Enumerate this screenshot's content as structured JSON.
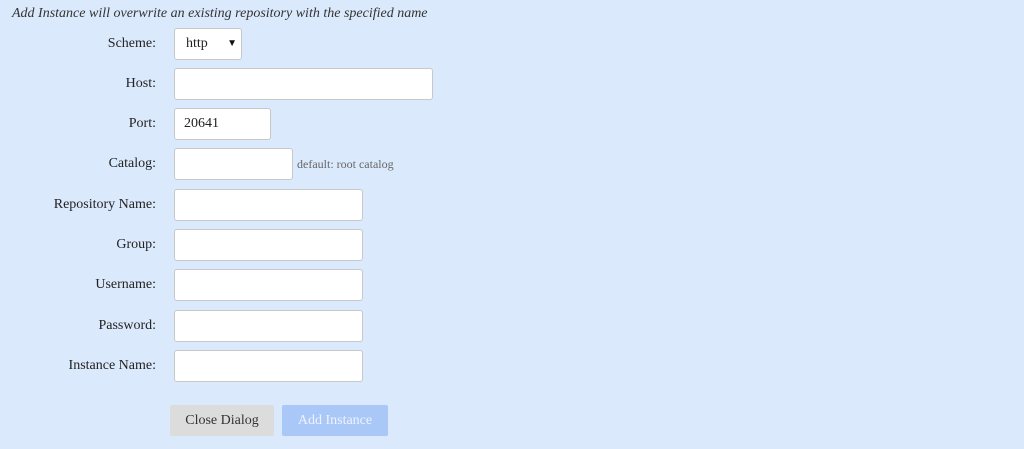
{
  "note": "Add Instance will overwrite an existing repository with the specified name",
  "form": {
    "scheme": {
      "label": "Scheme:",
      "value": "http",
      "icon": "caret-down-icon"
    },
    "host": {
      "label": "Host:",
      "value": ""
    },
    "port": {
      "label": "Port:",
      "value": "20641"
    },
    "catalog": {
      "label": "Catalog:",
      "value": "",
      "hint": "default: root catalog"
    },
    "repository_name": {
      "label": "Repository Name:",
      "value": ""
    },
    "group": {
      "label": "Group:",
      "value": ""
    },
    "username": {
      "label": "Username:",
      "value": ""
    },
    "password": {
      "label": "Password:",
      "value": ""
    },
    "instance_name": {
      "label": "Instance Name:",
      "value": ""
    }
  },
  "buttons": {
    "close": "Close Dialog",
    "add": "Add Instance"
  },
  "colors": {
    "background": "#dbe9fc",
    "close_button": "#dcdcdc",
    "add_button_disabled": "#a9c7f7"
  }
}
